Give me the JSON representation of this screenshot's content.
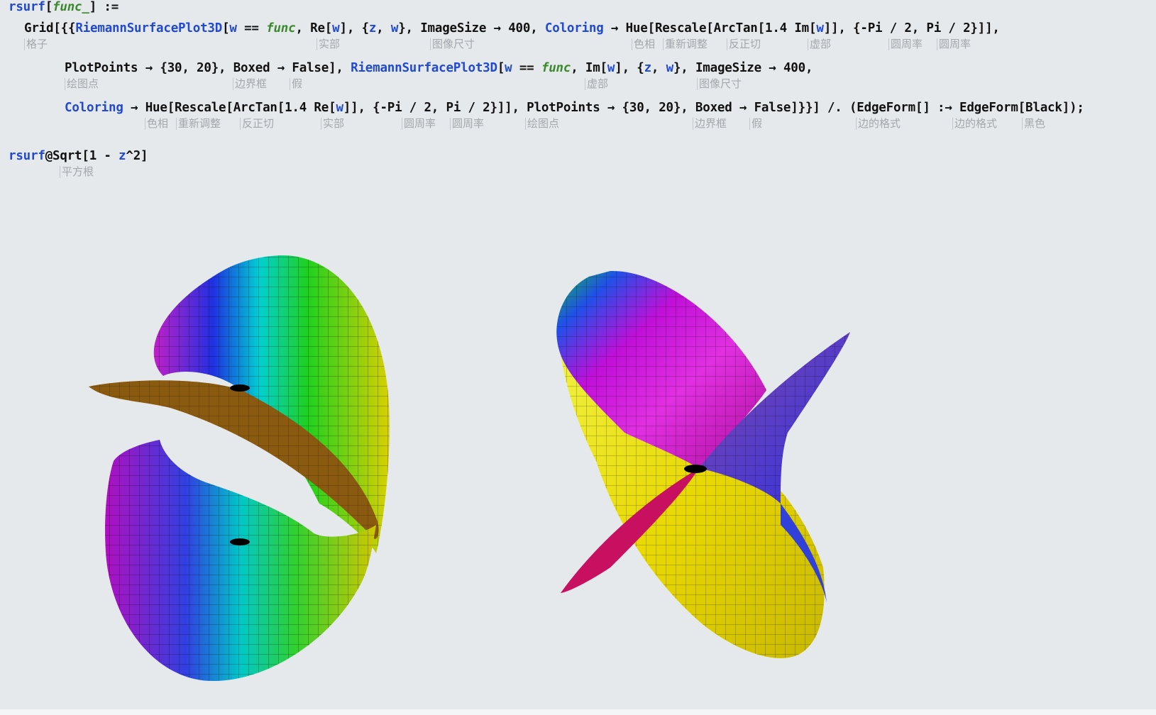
{
  "input1": {
    "line1": [
      "rsurf",
      "[",
      "func_",
      "] :="
    ],
    "line2": {
      "pre": "Grid[{{",
      "fn1": "RiemannSurfacePlot3D",
      "a": "[",
      "w1": "w",
      "eq": " == ",
      "func1": "func",
      "b": ", Re[",
      "w2": "w",
      "c": "], {",
      "z1": "z",
      "d": ", ",
      "w3": "w",
      "e": "}, ImageSize → 400, ",
      "col1": "Coloring",
      "f": " → Hue[Rescale[ArcTan[1.4 Im[",
      "w4": "w",
      "g": "]], {-Pi / 2, Pi / 2}]],"
    },
    "line3": {
      "a": "PlotPoints → {30, 20}, Boxed → False], ",
      "fn2": "RiemannSurfacePlot3D",
      "b": "[",
      "w1": "w",
      "eq": " == ",
      "func2": "func",
      "c": ", Im[",
      "w2": "w",
      "d": "], {",
      "z1": "z",
      "e": ", ",
      "w3": "w",
      "f": "}, ImageSize → 400,"
    },
    "line4": {
      "col2": "Coloring",
      "a": " → Hue[Rescale[ArcTan[1.4 Re[",
      "w1": "w",
      "b": "]], {-Pi / 2, Pi / 2}]], PlotPoints → {30, 20}, Boxed → False]}}] /. (EdgeForm[] :→ EdgeForm[Black]);"
    },
    "annotations": {
      "grid": "格子",
      "re1": "实部",
      "imagesize1": "图像尺寸",
      "hue1": "色相",
      "rescale1": "重新调整",
      "arctan1": "反正切",
      "im1": "虚部",
      "pi1": "圆周率",
      "pi2": "圆周率",
      "plotpoints1": "绘图点",
      "boxed1": "边界框",
      "false1": "假",
      "im2": "虚部",
      "imagesize2": "图像尺寸",
      "hue2": "色相",
      "rescale2": "重新调整",
      "arctan2": "反正切",
      "re2": "实部",
      "pi3": "圆周率",
      "pi4": "圆周率",
      "plotpoints2": "绘图点",
      "boxed2": "边界框",
      "false2": "假",
      "edgeform1": "边的格式",
      "edgeform2": "边的格式",
      "black": "黑色"
    }
  },
  "input2": {
    "head": "rsurf",
    "at": "@Sqrt[1 - ",
    "z": "z",
    "tail": "^2]",
    "annotation": "平方根"
  },
  "colors": {
    "background": "#e6e9ec",
    "keyword_blue": "#2049d4",
    "pattern_green": "#3a8a2c",
    "annotation_gray": "#a3a8ad"
  }
}
